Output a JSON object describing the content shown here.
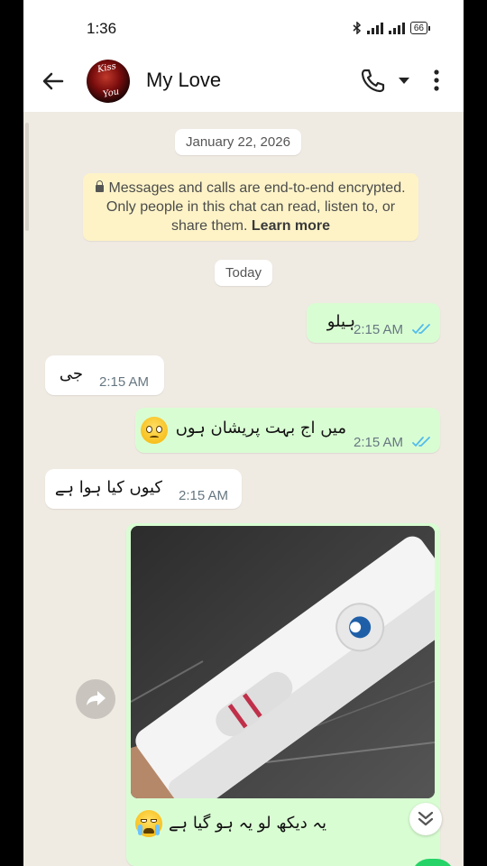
{
  "status_bar": {
    "time": "1:36",
    "battery": "66"
  },
  "header": {
    "contact_name": "My Love",
    "avatar_text": [
      "Kiss",
      "You"
    ]
  },
  "chat": {
    "date_chip": "January 22, 2026",
    "encryption_notice": {
      "text": "Messages and calls are end-to-end encrypted. Only people in this chat can read, listen to, or share them.",
      "link": "Learn more"
    },
    "today_chip": "Today",
    "messages": [
      {
        "direction": "out",
        "text": "ہیلو",
        "time": "2:15 AM",
        "status": "read"
      },
      {
        "direction": "in",
        "text": "جی",
        "time": "2:15 AM"
      },
      {
        "direction": "out",
        "text": "میں اج بہت پریشان ہوں",
        "emoji": "pleading-face",
        "time": "2:15 AM",
        "status": "read"
      },
      {
        "direction": "in",
        "text": "کیوں کیا ہوا ہے",
        "time": "2:15 AM"
      },
      {
        "direction": "out",
        "type": "image",
        "caption": "یہ دیکھ لو یہ ہو گیا ہے",
        "caption_emoji": "crying-face"
      }
    ]
  },
  "colors": {
    "chat_bg": "#efeae2",
    "outgoing_bubble": "#d9fdd3",
    "incoming_bubble": "#ffffff",
    "read_ticks": "#53bdeb",
    "accent": "#25d366"
  }
}
